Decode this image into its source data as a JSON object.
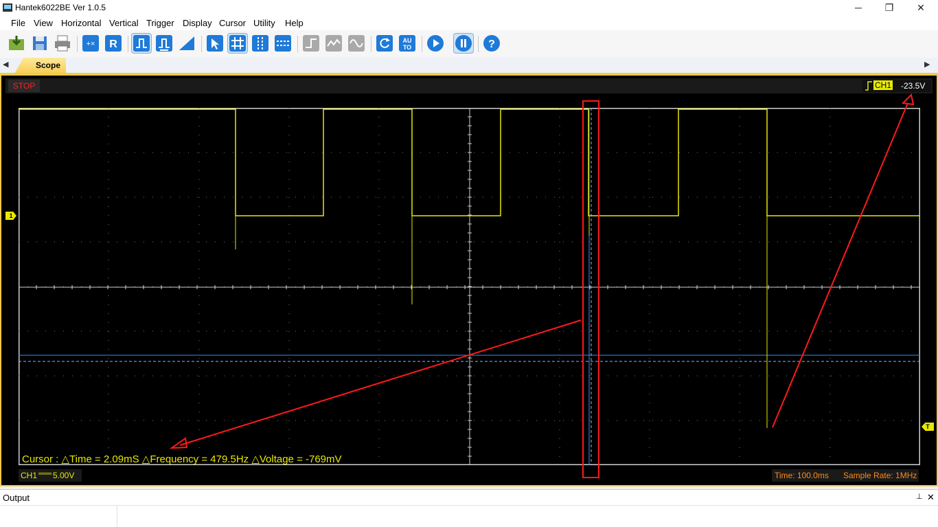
{
  "window": {
    "title": "Hantek6022BE Ver 1.0.5",
    "minimize": "─",
    "maximize": "❐",
    "close": "✕"
  },
  "menu": [
    "File",
    "View",
    "Horizontal",
    "Vertical",
    "Trigger",
    "Display",
    "Cursor",
    "Utility",
    "Help"
  ],
  "toolbar_icons": [
    "open-icon",
    "save-icon",
    "print-icon",
    "math-icon",
    "reference-icon",
    "pulse-trigger-icon",
    "pulse-measure-icon",
    "ramp-icon",
    "select-cursor-icon",
    "grid-icon",
    "vertical-cursor-icon",
    "horizontal-cursor-icon",
    "step-icon",
    "wave-icon",
    "sine-icon",
    "refresh-icon",
    "auto-icon",
    "run-icon",
    "pause-icon",
    "help-icon"
  ],
  "toolbar": {
    "auto_label": "AU TO",
    "help_label": "?",
    "ref_label": "R"
  },
  "tabs": {
    "scope": "Scope",
    "left_arrow": "◀",
    "right_arrow": "▶"
  },
  "status": {
    "run_state": "STOP"
  },
  "trigger": {
    "channel": "CH1",
    "level": "-23.5V"
  },
  "markers": {
    "ch1": "1",
    "trigger": "T"
  },
  "cursor_readout": "Cursor : △Time = 2.09mS  △Frequency = 479.5Hz  △Voltage = -769mV",
  "channel_info": {
    "label": "CH1",
    "coupling": "═══",
    "scale": "5.00V"
  },
  "timebase": {
    "time": "Time: 100.0ms",
    "sample_rate": "Sample Rate: 1MHz"
  },
  "output_panel": {
    "title": "Output",
    "pin": "⊥",
    "close": "✕"
  },
  "colors": {
    "trace": "#e8e800",
    "cursor": "#2f8fff",
    "annotation": "#ff1a1a",
    "frame": "#f2c94c"
  }
}
